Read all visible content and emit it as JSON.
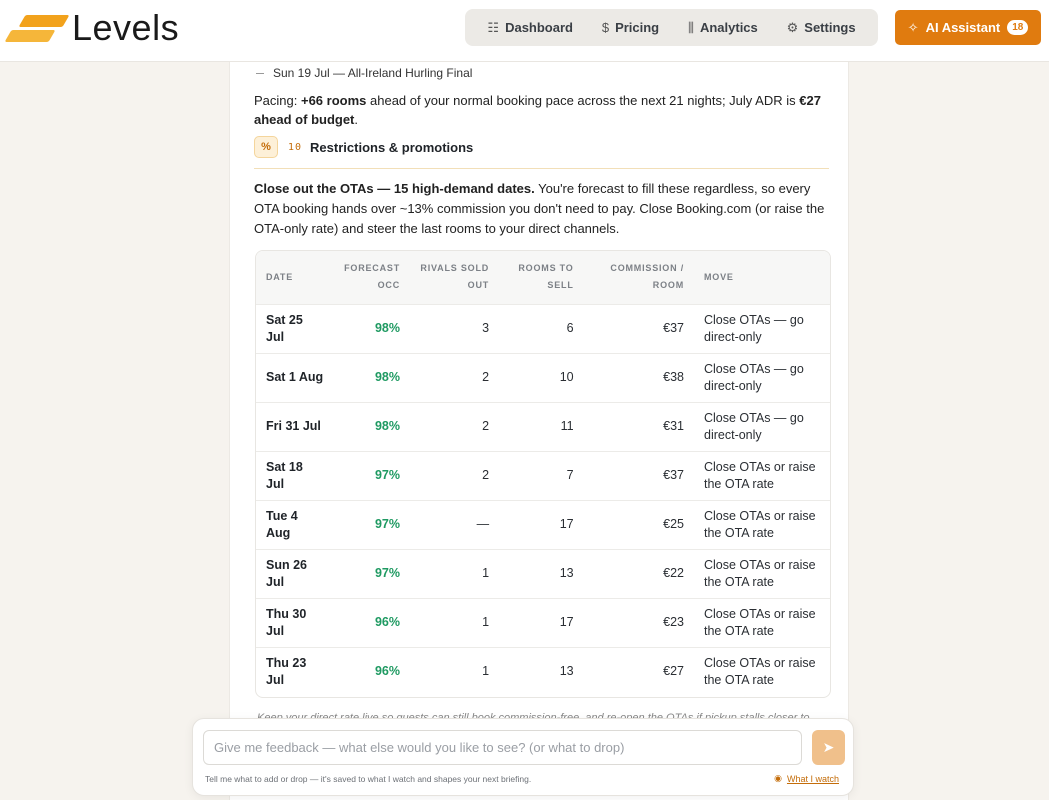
{
  "brand": {
    "name": "Levels"
  },
  "nav": {
    "items": [
      {
        "icon": "grid-icon",
        "glyph": "☷",
        "label": "Dashboard"
      },
      {
        "icon": "dollar-icon",
        "glyph": "$",
        "label": "Pricing"
      },
      {
        "icon": "bar-chart-icon",
        "glyph": "⫼",
        "label": "Analytics"
      },
      {
        "icon": "gear-icon",
        "glyph": "⚙",
        "label": "Settings"
      }
    ]
  },
  "ai_button": {
    "label": "AI Assistant",
    "badge": "18",
    "glyph": "✧"
  },
  "event": {
    "text": "Sun 19 Jul — All-Ireland Hurling Final"
  },
  "pacing": {
    "prefix": "Pacing: ",
    "rooms": "+66 rooms",
    "middle": " ahead of your normal booking pace across the next 21 nights; July ADR is ",
    "adr": "€27 ahead of budget",
    "suffix": "."
  },
  "section": {
    "icon_glyph": "%",
    "number": "10",
    "title": "Restrictions & promotions"
  },
  "intro": {
    "bold": "Close out the OTAs — 15 high-demand dates.",
    "rest": " You're forecast to fill these regardless, so every OTA booking hands over ~13% commission you don't need to pay. Close Booking.com (or raise the OTA-only rate) and steer the last rooms to your direct channels."
  },
  "table": {
    "headers": [
      "DATE",
      "FORECAST OCC",
      "RIVALS SOLD OUT",
      "ROOMS TO SELL",
      "COMMISSION / ROOM",
      "MOVE"
    ],
    "rows": [
      {
        "date": "Sat 25 Jul",
        "occ": "98%",
        "rivals": "3",
        "rooms": "6",
        "commission": "€37",
        "move": "Close OTAs — go direct-only"
      },
      {
        "date": "Sat 1 Aug",
        "occ": "98%",
        "rivals": "2",
        "rooms": "10",
        "commission": "€38",
        "move": "Close OTAs — go direct-only"
      },
      {
        "date": "Fri 31 Jul",
        "occ": "98%",
        "rivals": "2",
        "rooms": "11",
        "commission": "€31",
        "move": "Close OTAs — go direct-only"
      },
      {
        "date": "Sat 18 Jul",
        "occ": "97%",
        "rivals": "2",
        "rooms": "7",
        "commission": "€37",
        "move": "Close OTAs or raise the OTA rate"
      },
      {
        "date": "Tue 4 Aug",
        "occ": "97%",
        "rivals": "—",
        "rooms": "17",
        "commission": "€25",
        "move": "Close OTAs or raise the OTA rate"
      },
      {
        "date": "Sun 26 Jul",
        "occ": "97%",
        "rivals": "1",
        "rooms": "13",
        "commission": "€22",
        "move": "Close OTAs or raise the OTA rate"
      },
      {
        "date": "Thu 30 Jul",
        "occ": "96%",
        "rivals": "1",
        "rooms": "17",
        "commission": "€23",
        "move": "Close OTAs or raise the OTA rate"
      },
      {
        "date": "Thu 23 Jul",
        "occ": "96%",
        "rivals": "1",
        "rooms": "13",
        "commission": "€27",
        "move": "Close OTAs or raise the OTA rate"
      }
    ]
  },
  "footnote": "Keep your direct rate live so guests can still book commission-free, and re-open the OTAs if pickup stalls closer to",
  "feedback": {
    "placeholder": "Give me feedback — what else would you like to see? (or what to drop)",
    "hint": "Tell me what to add or drop — it's saved to what I watch and shapes your next briefing.",
    "link_label": "What I watch",
    "send_glyph": "➤"
  },
  "colors": {
    "accent": "#e07b0f",
    "positive": "#1f9a62",
    "logo_orange": "#f2a21c"
  }
}
